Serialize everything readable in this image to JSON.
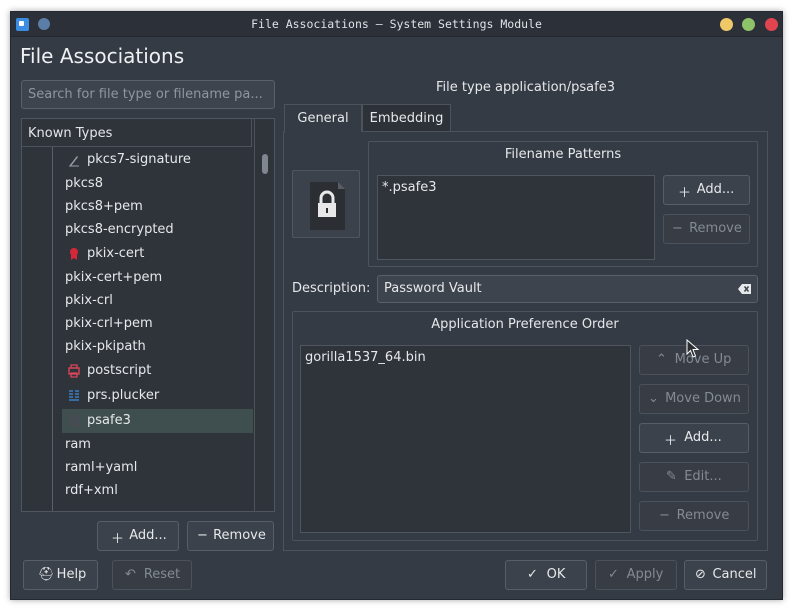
{
  "window": {
    "title": "File Associations — System Settings Module"
  },
  "page": {
    "heading": "File Associations"
  },
  "search": {
    "placeholder": "Search for file type or filename pa..."
  },
  "tree": {
    "header": "Known Types",
    "items": [
      {
        "label": "pkcs7-signature",
        "icon": "signature-icon"
      },
      {
        "label": "pkcs8",
        "icon": ""
      },
      {
        "label": "pkcs8+pem",
        "icon": ""
      },
      {
        "label": "pkcs8-encrypted",
        "icon": ""
      },
      {
        "label": "pkix-cert",
        "icon": "certificate-icon"
      },
      {
        "label": "pkix-cert+pem",
        "icon": ""
      },
      {
        "label": "pkix-crl",
        "icon": ""
      },
      {
        "label": "pkix-crl+pem",
        "icon": ""
      },
      {
        "label": "pkix-pkipath",
        "icon": ""
      },
      {
        "label": "postscript",
        "icon": "printer-icon"
      },
      {
        "label": "prs.plucker",
        "icon": "document-icon"
      },
      {
        "label": "psafe3",
        "icon": "lock-file-icon"
      },
      {
        "label": "ram",
        "icon": ""
      },
      {
        "label": "raml+yaml",
        "icon": ""
      },
      {
        "label": "rdf+xml",
        "icon": ""
      }
    ],
    "selected": "psafe3"
  },
  "left_buttons": {
    "add": "Add...",
    "remove": "Remove"
  },
  "filetype": {
    "title": "File type application/psafe3"
  },
  "tabs": [
    {
      "label": "General",
      "active": true
    },
    {
      "label": "Embedding",
      "active": false
    }
  ],
  "filename_patterns": {
    "title": "Filename Patterns",
    "items": [
      "*.psafe3"
    ],
    "add": "Add...",
    "remove": "Remove"
  },
  "description": {
    "label": "Description:",
    "value": "Password Vault"
  },
  "app_pref": {
    "title": "Application Preference Order",
    "items": [
      "gorilla1537_64.bin"
    ],
    "move_up": "Move Up",
    "move_down": "Move Down",
    "add": "Add...",
    "edit": "Edit...",
    "remove": "Remove"
  },
  "bottom": {
    "help": "Help",
    "reset": "Reset",
    "ok": "OK",
    "apply": "Apply",
    "cancel": "Cancel"
  },
  "colors": {
    "window_bg": "#353b44",
    "selection": "#3f4e4e",
    "close": "#e0454f",
    "maximize": "#8fc36a",
    "minimize": "#f0c868"
  }
}
